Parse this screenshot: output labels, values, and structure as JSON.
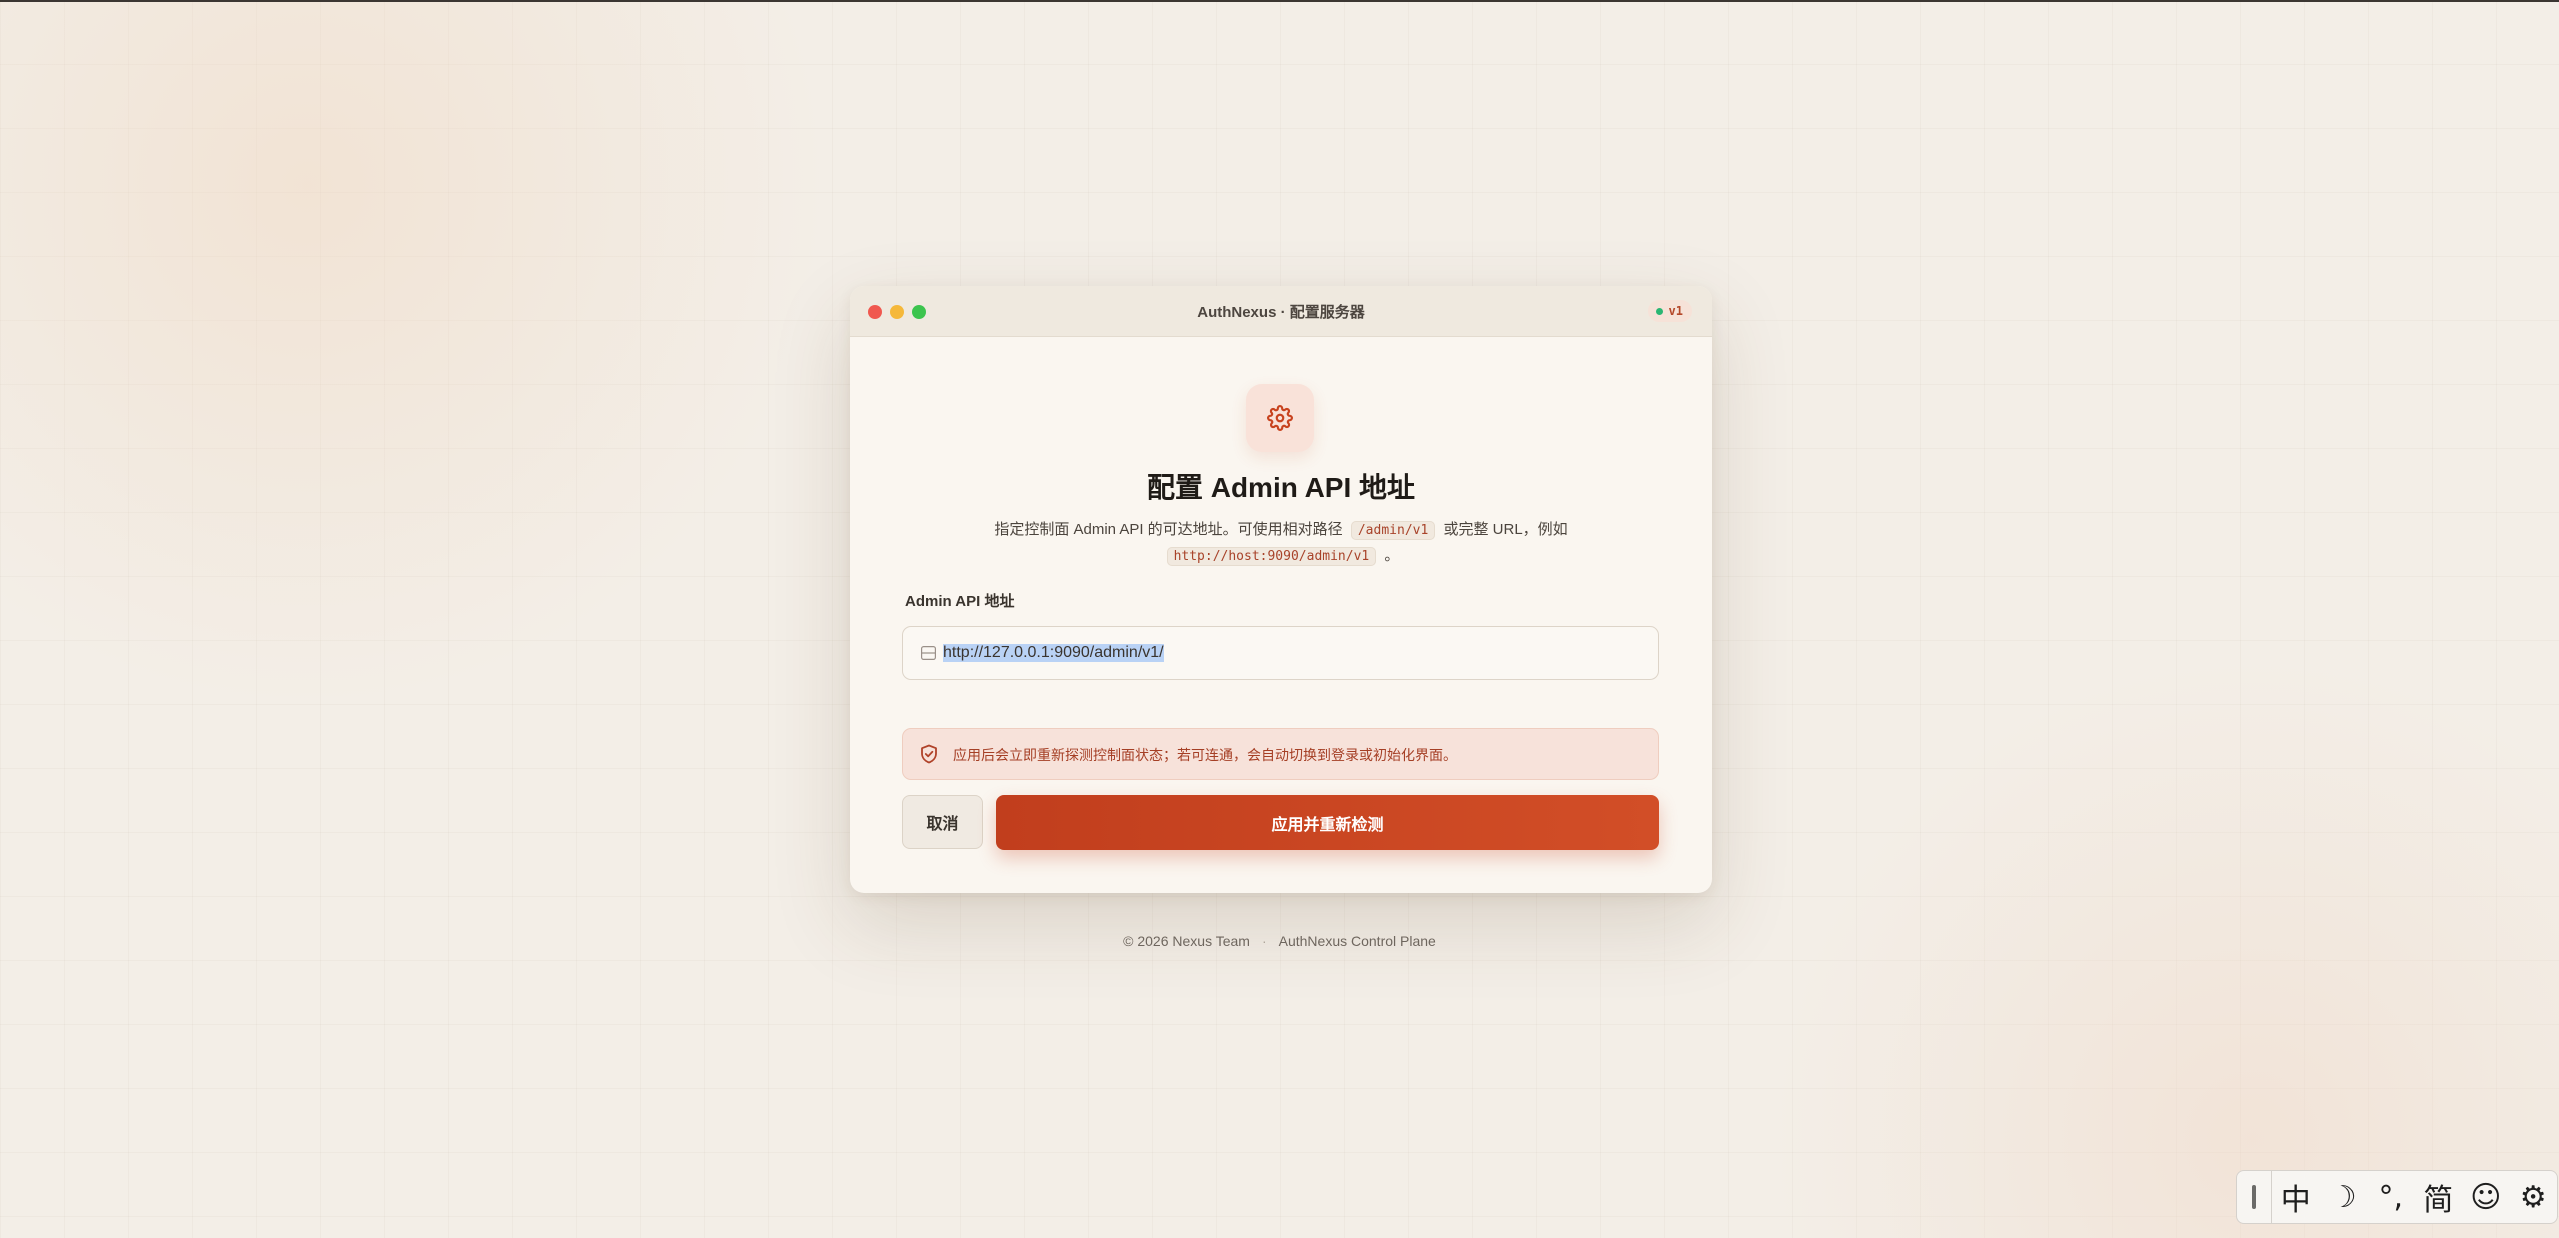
{
  "window": {
    "title": "AuthNexus · 配置服务器",
    "version_badge": "v1",
    "status_dot_color": "#2bb673"
  },
  "dialog": {
    "icon": "gear-icon",
    "heading": "配置 Admin API 地址",
    "description_part1": "指定控制面 Admin API 的可达地址。可使用相对路径",
    "description_code1": "/admin/v1",
    "description_part2": "或完整 URL，例如",
    "description_code2": "http://host:9090/admin/v1",
    "description_part3": "。",
    "field_label": "Admin API 地址",
    "input_value": "http://127.0.0.1:9090/admin/v1/",
    "notice_icon": "shield-check-icon",
    "notice_text": "应用后会立即重新探测控制面状态；若可连通，会自动切换到登录或初始化界面。",
    "cancel_label": "取消",
    "apply_label": "应用并重新检测"
  },
  "footer": {
    "copyright": "© 2026 Nexus Team",
    "separator": "·",
    "product": "AuthNexus Control Plane"
  },
  "ime": {
    "items": [
      "中",
      "☽",
      "°,",
      "简",
      "☺",
      "⚙"
    ],
    "icons": [
      "chinese-mode-icon",
      "moon-icon",
      "punctuation-icon",
      "simplified-icon",
      "emoji-icon",
      "settings-icon"
    ]
  },
  "colors": {
    "accent": "#c8431f",
    "background": "#f3eee7",
    "card": "#faf6f0"
  }
}
